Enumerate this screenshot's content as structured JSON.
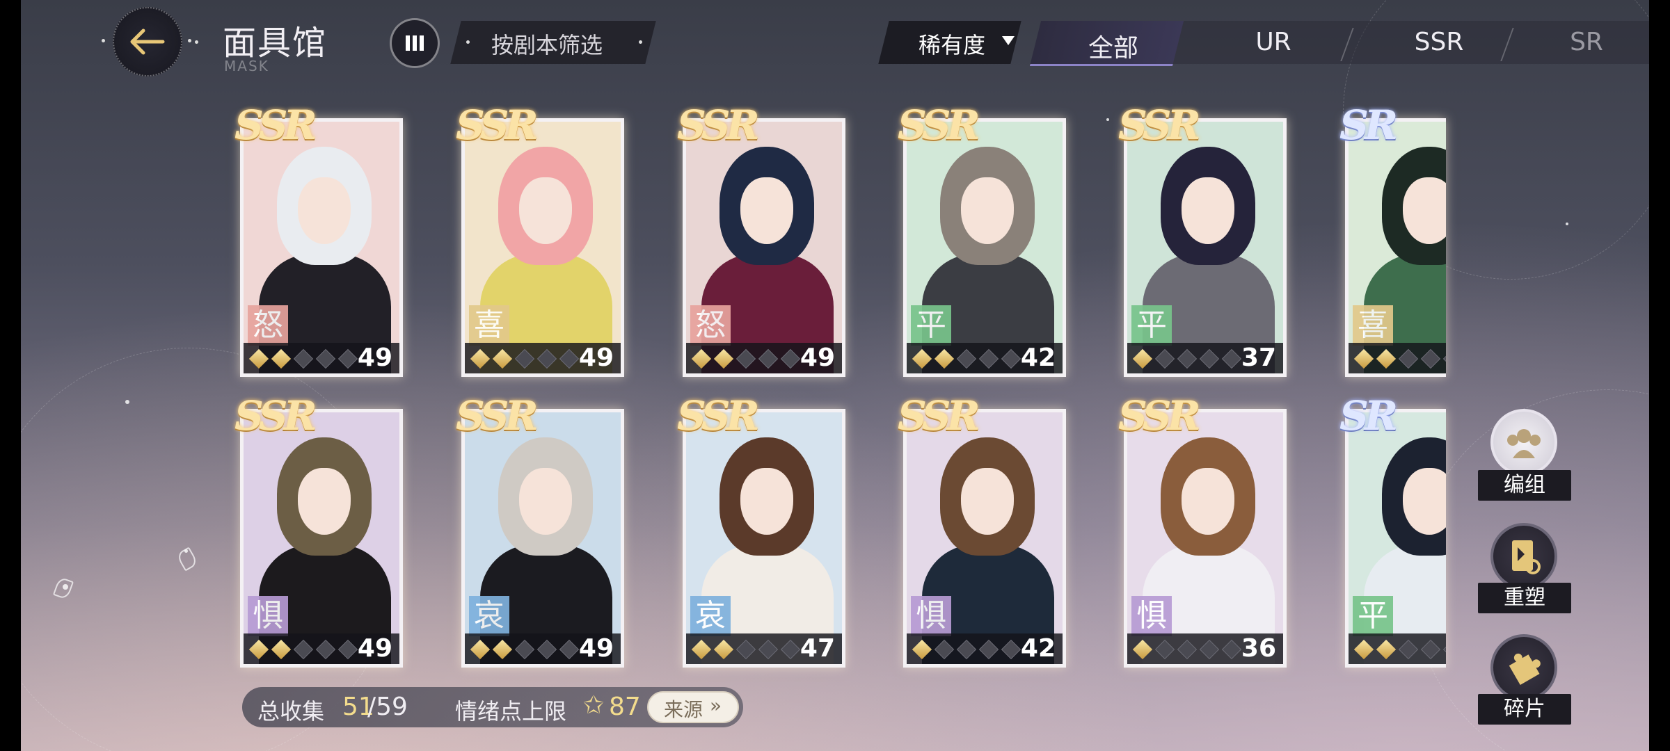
{
  "header": {
    "title": "面具馆",
    "subtitle": "MASK",
    "script_filter_label": "按剧本筛选"
  },
  "rarity_filter": {
    "dropdown_label": "稀有度",
    "tabs": [
      "全部",
      "UR",
      "SSR",
      "SR"
    ],
    "selected": "全部"
  },
  "cards": [
    {
      "rarity": "SSR",
      "emotion": "怒",
      "level": "49",
      "stars": 2,
      "emotion_color": "#e7a39d",
      "art": {
        "bg": "#f0d7d5",
        "hair": "#e9ecf0",
        "body": "#222027"
      }
    },
    {
      "rarity": "SSR",
      "emotion": "喜",
      "level": "49",
      "stars": 2,
      "emotion_color": "#e2c98a",
      "art": {
        "bg": "#f2e4cb",
        "hair": "#f1a5a6",
        "body": "#e2d36a"
      }
    },
    {
      "rarity": "SSR",
      "emotion": "怒",
      "level": "49",
      "stars": 2,
      "emotion_color": "#e7a39d",
      "art": {
        "bg": "#e9d6d4",
        "hair": "#1f2a44",
        "body": "#6a1e3a"
      }
    },
    {
      "rarity": "SSR",
      "emotion": "平",
      "level": "42",
      "stars": 2,
      "emotion_color": "#78c48b",
      "art": {
        "bg": "#d2e8d8",
        "hair": "#8a8179",
        "body": "#3b3d43"
      }
    },
    {
      "rarity": "SSR",
      "emotion": "平",
      "level": "37",
      "stars": 1,
      "emotion_color": "#78c48b",
      "art": {
        "bg": "#cfe4d8",
        "hair": "#25233a",
        "body": "#6c6b74"
      }
    },
    {
      "rarity": "SR",
      "emotion": "喜",
      "level": "",
      "stars": 2,
      "emotion_color": "#e2c98a",
      "art": {
        "bg": "#dbead8",
        "hair": "#1d2a24",
        "body": "#3e6e4d"
      }
    },
    {
      "rarity": "SSR",
      "emotion": "惧",
      "level": "49",
      "stars": 2,
      "emotion_color": "#b79bd4",
      "art": {
        "bg": "#ddd0e6",
        "hair": "#6c5e45",
        "body": "#1c1a1d"
      }
    },
    {
      "rarity": "SSR",
      "emotion": "哀",
      "level": "49",
      "stars": 2,
      "emotion_color": "#7fb1dd",
      "art": {
        "bg": "#cbdcea",
        "hair": "#cfcac4",
        "body": "#1b1b20"
      }
    },
    {
      "rarity": "SSR",
      "emotion": "哀",
      "level": "47",
      "stars": 2,
      "emotion_color": "#7fb1dd",
      "art": {
        "bg": "#d6e3ee",
        "hair": "#5b3a2a",
        "body": "#f1ece6"
      }
    },
    {
      "rarity": "SSR",
      "emotion": "惧",
      "level": "42",
      "stars": 1,
      "emotion_color": "#b79bd4",
      "art": {
        "bg": "#e4d9e8",
        "hair": "#6b4a33",
        "body": "#1e2a3a"
      }
    },
    {
      "rarity": "SSR",
      "emotion": "惧",
      "level": "36",
      "stars": 1,
      "emotion_color": "#b79bd4",
      "art": {
        "bg": "#e7dcea",
        "hair": "#8a5d3c",
        "body": "#f0eef3"
      }
    },
    {
      "rarity": "SR",
      "emotion": "平",
      "level": "",
      "stars": 2,
      "emotion_color": "#78c48b",
      "art": {
        "bg": "#d6e8e0",
        "hair": "#1c2230",
        "body": "#e7ecf1"
      }
    }
  ],
  "side_buttons": {
    "group_label": "编组",
    "reshape_label": "重塑",
    "fragment_label": "碎片"
  },
  "bottom_bar": {
    "collect_label": "总收集",
    "collect_count": "51",
    "collect_total": "/59",
    "emotion_label": "情绪点上限",
    "emotion_star": "✩",
    "emotion_value": "87",
    "source_label": "来源",
    "source_chevron": "»"
  }
}
